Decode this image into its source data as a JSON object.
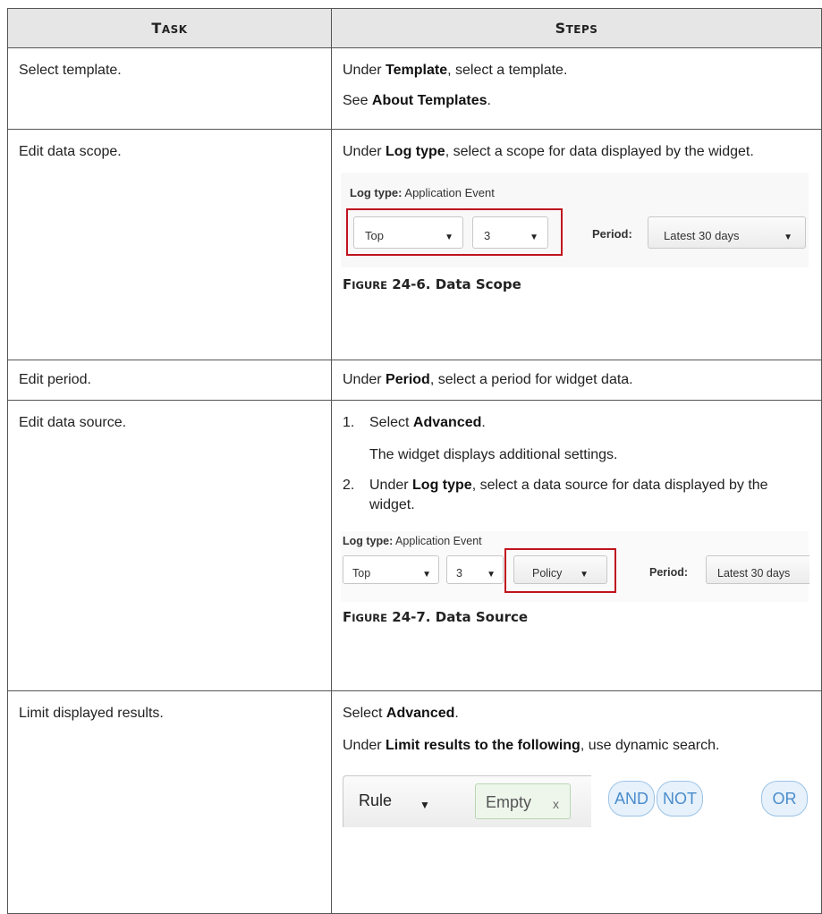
{
  "header": {
    "task": "Task",
    "steps": "Steps"
  },
  "rows": {
    "r1": {
      "task": "Select template.",
      "s1_pre": "Under ",
      "s1_b": "Template",
      "s1_post": ", select a template.",
      "s2_pre": "See ",
      "s2_b": "About Templates",
      "s2_post": "."
    },
    "r2": {
      "task": "Edit data scope.",
      "s1_pre": "Under ",
      "s1_b": "Log type",
      "s1_post": ", select a scope for data displayed by the widget.",
      "figure": {
        "log_label": "Log type:",
        "log_value": "Application Event",
        "sel1": "Top",
        "sel2": "3",
        "period_label": "Period:",
        "period_value": "Latest 30 days",
        "caption_num": "24-6.",
        "caption_text": "Data Scope",
        "caption_word": "Figure"
      }
    },
    "r3": {
      "task": "Edit period.",
      "s1_pre": "Under ",
      "s1_b": "Period",
      "s1_post": ", select a period for widget data."
    },
    "r4": {
      "task": "Edit data source.",
      "step1_num": "1.",
      "step1_pre": "Select ",
      "step1_b": "Advanced",
      "step1_post": ".",
      "step1_note": "The widget displays additional settings.",
      "step2_num": "2.",
      "step2_pre": "Under ",
      "step2_b": "Log type",
      "step2_post": ", select a data source for data displayed by the widget.",
      "figure": {
        "log_label": "Log type:",
        "log_value": "Application Event",
        "sel1": "Top",
        "sel2": "3",
        "policy": "Policy",
        "period_label": "Period:",
        "period_value": "Latest 30 days",
        "caption_num": "24-7.",
        "caption_text": "Data Source",
        "caption_word": "Figure"
      }
    },
    "r5": {
      "task": "Limit displayed results.",
      "s1_pre": "Select ",
      "s1_b": "Advanced",
      "s1_post": ".",
      "s2_pre": "Under ",
      "s2_b": "Limit results to the following",
      "s2_post": ", use dynamic search.",
      "figure": {
        "rule": "Rule",
        "empty": "Empty",
        "x": "x",
        "and": "AND",
        "not": "NOT",
        "or": "OR"
      }
    }
  }
}
